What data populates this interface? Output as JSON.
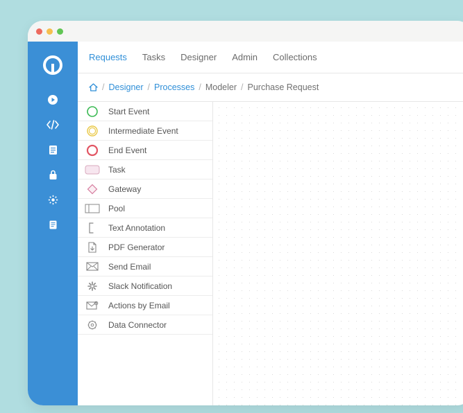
{
  "nav": {
    "items": [
      {
        "label": "Requests",
        "active": true
      },
      {
        "label": "Tasks",
        "active": false
      },
      {
        "label": "Designer",
        "active": false
      },
      {
        "label": "Admin",
        "active": false
      },
      {
        "label": "Collections",
        "active": false
      }
    ]
  },
  "breadcrumb": {
    "home_icon": "home",
    "parts": [
      {
        "label": "Designer",
        "link": true
      },
      {
        "label": "Processes",
        "link": true
      },
      {
        "label": "Modeler",
        "link": false
      },
      {
        "label": "Purchase Request",
        "link": false
      }
    ]
  },
  "sidebar": {
    "icons": [
      "play-circle",
      "code",
      "document",
      "lock",
      "gear",
      "clipboard"
    ]
  },
  "palette": {
    "items": [
      {
        "label": "Start Event",
        "icon": "start-event"
      },
      {
        "label": "Intermediate Event",
        "icon": "intermediate-event"
      },
      {
        "label": "End Event",
        "icon": "end-event"
      },
      {
        "label": "Task",
        "icon": "task"
      },
      {
        "label": "Gateway",
        "icon": "gateway"
      },
      {
        "label": "Pool",
        "icon": "pool"
      },
      {
        "label": "Text Annotation",
        "icon": "text-annotation"
      },
      {
        "label": "PDF Generator",
        "icon": "pdf-generator"
      },
      {
        "label": "Send Email",
        "icon": "send-email"
      },
      {
        "label": "Slack Notification",
        "icon": "slack-notification"
      },
      {
        "label": "Actions by Email",
        "icon": "actions-by-email"
      },
      {
        "label": "Data Connector",
        "icon": "data-connector"
      }
    ]
  }
}
